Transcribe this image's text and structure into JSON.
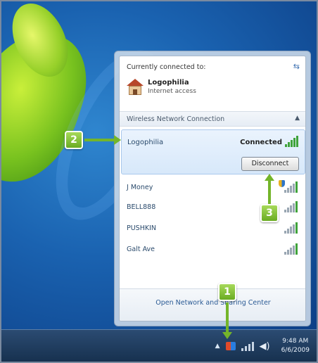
{
  "flyout": {
    "connected_header": "Currently connected to:",
    "current_network_name": "Logophilia",
    "current_network_access": "Internet access",
    "section_title": "Wireless Network Connection",
    "selected_network": {
      "name": "Logophilia",
      "status": "Connected",
      "disconnect_label": "Disconnect"
    },
    "networks": [
      {
        "name": "J Money",
        "secured_icon": "shield-icon"
      },
      {
        "name": "BELL888"
      },
      {
        "name": "PUSHKIN"
      },
      {
        "name": "Galt Ave"
      }
    ],
    "footer_link": "Open Network and Sharing Center"
  },
  "taskbar": {
    "time": "9:48 AM",
    "date": "6/6/2009"
  },
  "steps": {
    "step1": "1",
    "step2": "2",
    "step3": "3"
  },
  "colors": {
    "accent_green": "#74b52a",
    "link_blue": "#2a5a94"
  }
}
